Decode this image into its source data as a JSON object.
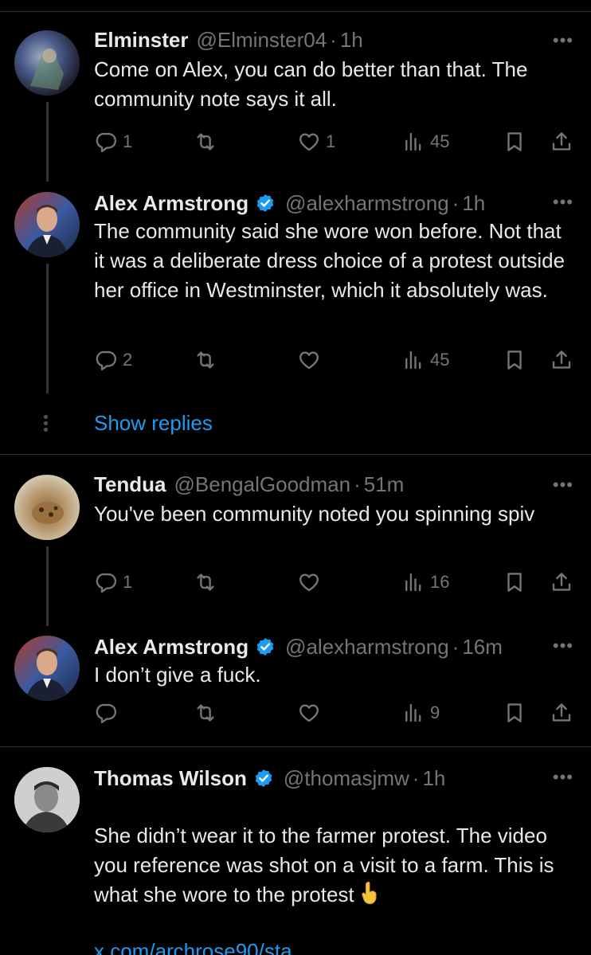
{
  "tweets": [
    {
      "name": "Elminster",
      "handle": "@Elminster04",
      "time": "1h",
      "text": "Come on Alex, you can do better than that. The community note says it all.",
      "replies": "1",
      "likes": "1",
      "views": "45",
      "avatar_color": "#3a4a6a"
    },
    {
      "name": "Alex Armstrong",
      "handle": "@alexharmstrong",
      "time": "1h",
      "text": "The community said she wore won before. Not that it was a deliberate dress choice of a protest outside her office in Westminster, which it absolutely was.",
      "replies": "2",
      "likes": "",
      "views": "45",
      "avatar_color": "#2c3e66"
    },
    {
      "name": "Tendua",
      "handle": "@BengalGoodman",
      "time": "51m",
      "text": "You've been community noted you spinning spiv",
      "replies": "1",
      "likes": "",
      "views": "16",
      "avatar_color": "#b7a690"
    },
    {
      "name": "Alex Armstrong",
      "handle": "@alexharmstrong",
      "time": "16m",
      "text": "I don’t give a fuck.",
      "replies": "",
      "likes": "",
      "views": "9",
      "avatar_color": "#2c3e66"
    },
    {
      "name": "Thomas Wilson",
      "handle": "@thomasjmw",
      "time": "1h",
      "text": "She didn’t wear it to the farmer protest. The video you reference was shot on a visit to a farm. This is what she wore to the protest",
      "link": "x.com/archrose90/sta...",
      "avatar_color": "#d8d8d8"
    }
  ],
  "show_replies_label": "Show replies",
  "more_label": "•••",
  "dot": "·",
  "colors": {
    "background": "#000000",
    "text": "#e7e9ea",
    "muted": "#71767b",
    "accent": "#1d9bf0",
    "verified": "#1d9bf0"
  },
  "icons": [
    "reply-icon",
    "retweet-icon",
    "like-icon",
    "views-icon",
    "bookmark-icon",
    "share-icon",
    "verified-badge-icon",
    "more-icon",
    "pointing-down-emoji"
  ]
}
